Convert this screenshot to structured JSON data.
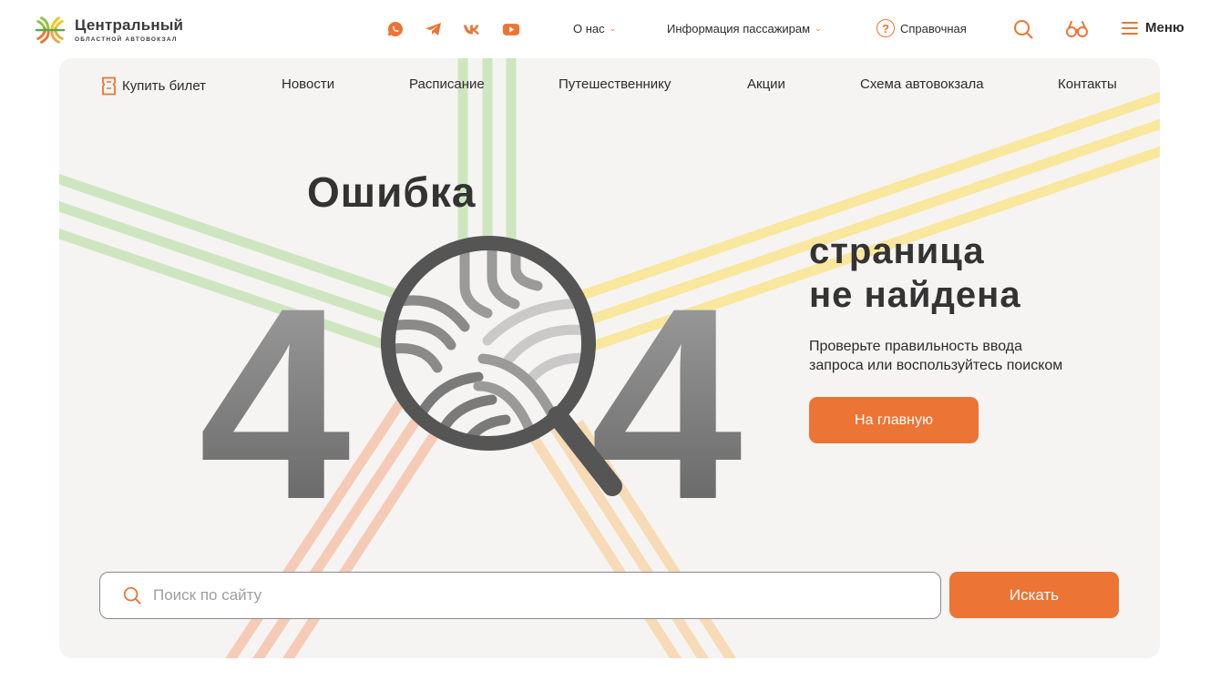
{
  "colors": {
    "accent": "#ec7434",
    "hero_bg": "#f5f4f2",
    "text": "#2b2b2b"
  },
  "header": {
    "logo_title": "Центральный",
    "logo_subtitle": "ОБЛАСТНОЙ АВТОВОКЗАЛ",
    "social_icons": [
      "whatsapp-icon",
      "telegram-icon",
      "vk-icon",
      "youtube-icon"
    ],
    "nav": [
      {
        "label": "О нас",
        "has_dropdown": true
      },
      {
        "label": "Информация пассажирам",
        "has_dropdown": true
      }
    ],
    "help_label": "Справочная",
    "search_icon": "search-icon",
    "accessibility_icon": "glasses-icon",
    "menu_label": "Меню"
  },
  "subnav": {
    "items": [
      {
        "label": "Купить билет",
        "icon": "ticket-icon"
      },
      {
        "label": "Новости"
      },
      {
        "label": "Расписание"
      },
      {
        "label": "Путешественнику"
      },
      {
        "label": "Акции"
      },
      {
        "label": "Схема автовокзала"
      },
      {
        "label": "Контакты"
      }
    ]
  },
  "error": {
    "word": "Ошибка",
    "code": "404",
    "title_line1": "страница",
    "title_line2": "не найдена",
    "desc_line1": "Проверьте правильность ввода",
    "desc_line2": "запроса или воспользуйтесь поиском",
    "home_button": "На главную"
  },
  "search": {
    "placeholder": "Поиск по сайту",
    "value": "",
    "button": "Искать"
  }
}
